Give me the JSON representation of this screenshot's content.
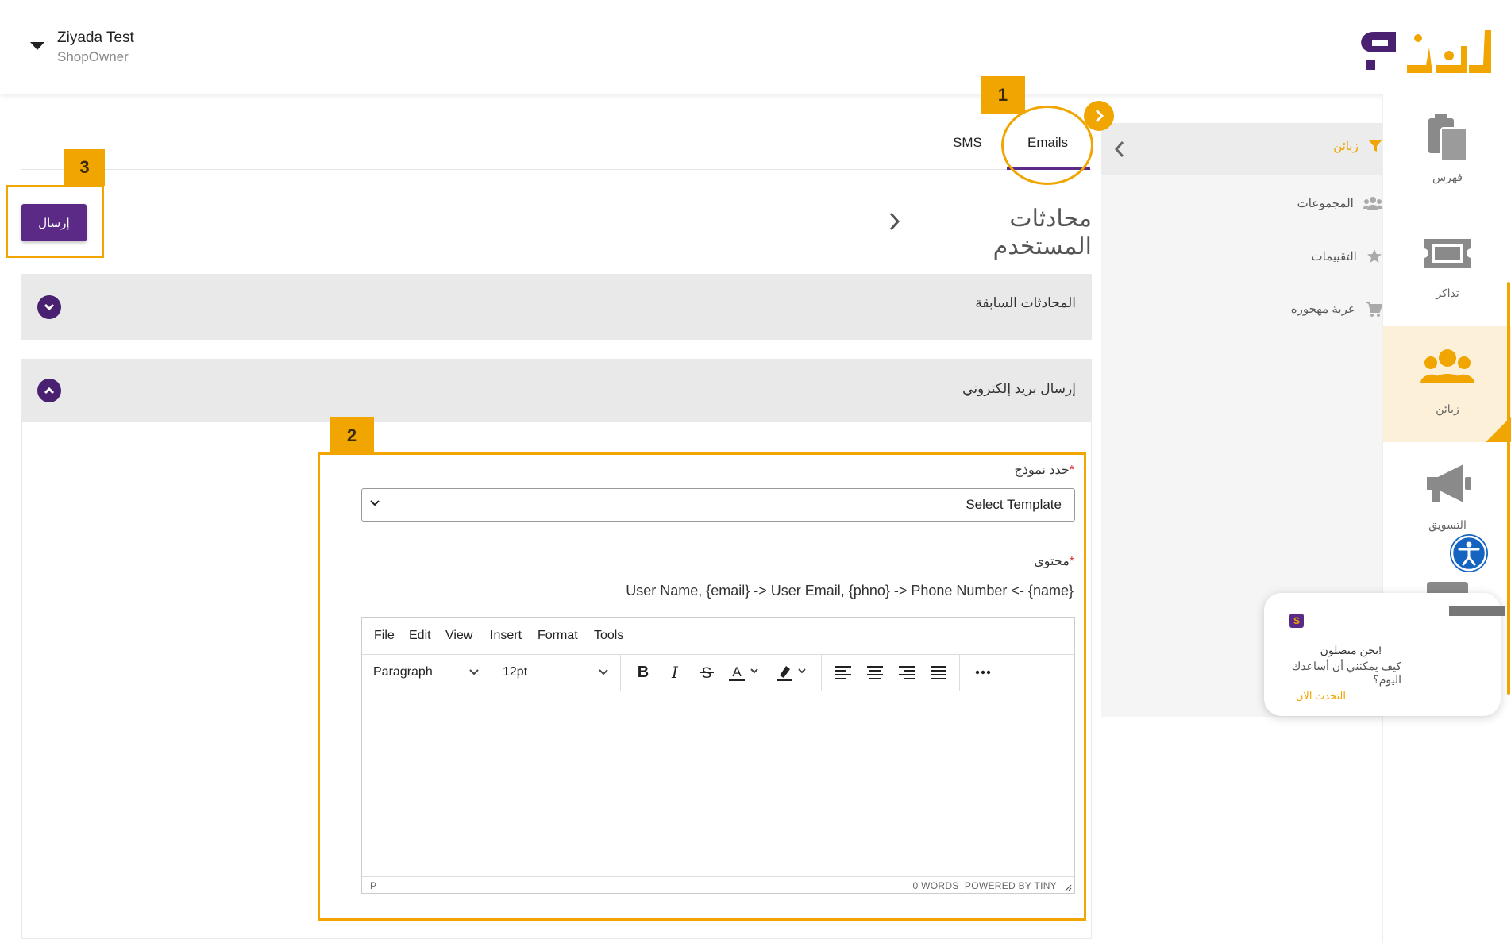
{
  "header": {
    "user_name": "Ziyada Test",
    "user_role": "ShopOwner"
  },
  "rail": {
    "items": [
      {
        "label": "فهرس",
        "icon": "clipboard-icon"
      },
      {
        "label": "تذاكر",
        "icon": "ticket-icon"
      },
      {
        "label": "زبائن",
        "icon": "users-icon",
        "active": true
      },
      {
        "label": "التسويق",
        "icon": "megaphone-icon"
      }
    ]
  },
  "submenu": {
    "header": "زبائن",
    "items": [
      {
        "label": "المجموعات",
        "icon": "group-icon"
      },
      {
        "label": "التقييمات",
        "icon": "star-icon"
      },
      {
        "label": "عربة مهجوره",
        "icon": "cart-icon"
      }
    ]
  },
  "tabs": [
    {
      "label": "SMS"
    },
    {
      "label": "Emails",
      "active": true
    }
  ],
  "page": {
    "title": "محادثات المستخدم",
    "send_label": "إرسال"
  },
  "accordions": {
    "previous": "المحادثات السابقة",
    "send_email": "إرسال بريد إلكتروني"
  },
  "form": {
    "template_label": "حدد نموذج",
    "template_value": "Select Template",
    "content_label": "محتوى",
    "placeholders_help": "User Name, {email} -> User Email, {phno} -> Phone Number <- {name}"
  },
  "editor": {
    "menu": [
      "File",
      "Edit",
      "View",
      "Insert",
      "Format",
      "Tools"
    ],
    "block_format": "Paragraph",
    "font_size": "12pt",
    "status_path": "P",
    "word_count": "0 WORDS",
    "powered_by": "POWERED BY TINY"
  },
  "annotations": {
    "tag1": "1",
    "tag2": "2",
    "tag3": "3"
  },
  "chat": {
    "line1": "!نحن متصلون",
    "line2": "كيف يمكنني أن أساعدك اليوم؟",
    "link": "التحدث الآن"
  },
  "colors": {
    "brand_purple": "#5b2a86",
    "accent_orange": "#f0a500"
  }
}
